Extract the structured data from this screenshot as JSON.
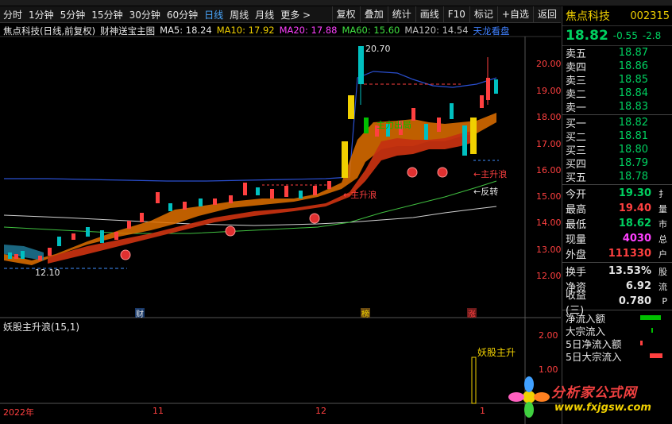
{
  "toolbar": {
    "periods": [
      "分时",
      "1分钟",
      "5分钟",
      "15分钟",
      "30分钟",
      "60分钟",
      "日线",
      "周线",
      "月线",
      "更多 >"
    ],
    "active_period": "日线",
    "tools": [
      "复权",
      "叠加",
      "统计",
      "画线",
      "F10",
      "标记",
      "+自选",
      "返回"
    ]
  },
  "chart": {
    "stock_label": "焦点科技(日线,前复权)",
    "indicator_name": "财神送宝主图",
    "ma5": "MA5: 18.24",
    "ma10": "MA10: 17.92",
    "ma20": "MA20: 17.88",
    "ma60": "MA60: 15.60",
    "ma120": "MA120: 14.54",
    "extra_label": "天龙看盘",
    "annotations": {
      "high": "20.70",
      "low": "12.10",
      "zhusheng1": "←主升浪",
      "zhusheng2": "←主升浪",
      "fanzhuan": "←反转",
      "zhuli": "主力出局"
    },
    "markers": [
      "财",
      "榜",
      "涨"
    ],
    "price_ticks": [
      "20.00",
      "19.00",
      "18.00",
      "17.00",
      "16.00",
      "15.00",
      "14.00",
      "13.00",
      "12.00"
    ],
    "date_ticks": [
      "2022年",
      "11",
      "12",
      "1"
    ]
  },
  "subchart": {
    "title": "妖股主升浪(15,1)",
    "label": "妖股主升",
    "ticks": [
      "2.00",
      "1.00"
    ]
  },
  "panel": {
    "name": "焦点科技",
    "code": "002315",
    "price": "18.82",
    "change": "-0.55",
    "change_pct": "-2.8",
    "asks": [
      {
        "label": "卖五",
        "price": "18.87"
      },
      {
        "label": "卖四",
        "price": "18.86"
      },
      {
        "label": "卖三",
        "price": "18.85"
      },
      {
        "label": "卖二",
        "price": "18.84"
      },
      {
        "label": "卖一",
        "price": "18.83"
      }
    ],
    "bids": [
      {
        "label": "买一",
        "price": "18.82"
      },
      {
        "label": "买二",
        "price": "18.81"
      },
      {
        "label": "买三",
        "price": "18.80"
      },
      {
        "label": "买四",
        "price": "18.79"
      },
      {
        "label": "买五",
        "price": "18.78"
      }
    ],
    "stats": [
      {
        "label": "今开",
        "value": "19.30",
        "tail": "扌",
        "color": "#00d060"
      },
      {
        "label": "最高",
        "value": "19.40",
        "tail": "量",
        "color": "#ff4040"
      },
      {
        "label": "最低",
        "value": "18.62",
        "tail": "市",
        "color": "#00d060"
      },
      {
        "label": "现量",
        "value": "4030",
        "tail": "总",
        "color": "#ff40ff"
      },
      {
        "label": "外盘",
        "value": "111330",
        "tail": "户",
        "color": "#ff4040"
      }
    ],
    "stats2": [
      {
        "label": "换手",
        "value": "13.53%",
        "tail": "股",
        "color": "#e6e6e6"
      },
      {
        "label": "净资",
        "value": "6.92",
        "tail": "流",
        "color": "#e6e6e6"
      },
      {
        "label": "收益(三)",
        "value": "0.780",
        "tail": "P",
        "color": "#e6e6e6"
      }
    ],
    "flows": [
      "净流入额",
      "大宗流入",
      "5日净流入额",
      "5日大宗流入"
    ]
  },
  "watermark": {
    "text": "分析家公式网",
    "url": "www.fxjgsw.com"
  }
}
